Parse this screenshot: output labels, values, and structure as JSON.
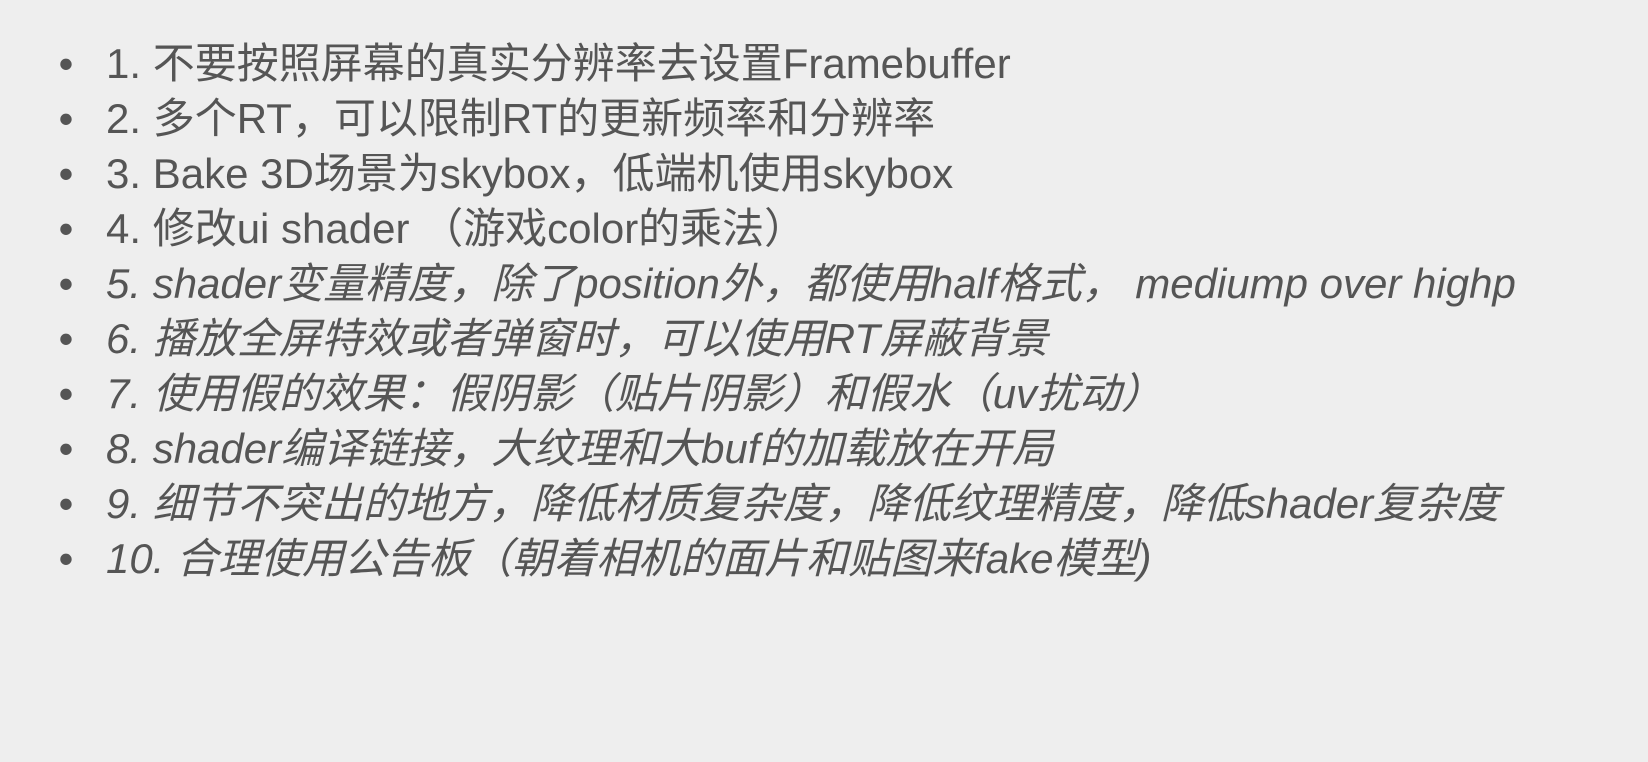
{
  "slide": {
    "bullet_glyph": "•",
    "items": [
      {
        "text": "1. 不要按照屏幕的真实分辨率去设置Framebuffer"
      },
      {
        "text": "2. 多个RT，可以限制RT的更新频率和分辨率"
      },
      {
        "text": "3. Bake 3D场景为skybox，低端机使用skybox"
      },
      {
        "text": "4. 修改ui shader （游戏color的乘法）"
      },
      {
        "text": "5. shader变量精度，除了position外，都使用half格式， mediump over highp"
      },
      {
        "text": "6. 播放全屏特效或者弹窗时，可以使用RT屏蔽背景"
      },
      {
        "text": "7. 使用假的效果：假阴影（贴片阴影）和假水（uv扰动）"
      },
      {
        "text": "8. shader编译链接，大纹理和大buf的加载放在开局"
      },
      {
        "text": "9. 细节不突出的地方，降低材质复杂度，降低纹理精度，降低shader复杂度"
      },
      {
        "text": "10. 合理使用公告板（朝着相机的面片和贴图来fake模型)"
      }
    ]
  },
  "colors": {
    "background": "#eeeeee",
    "text": "#555555"
  }
}
